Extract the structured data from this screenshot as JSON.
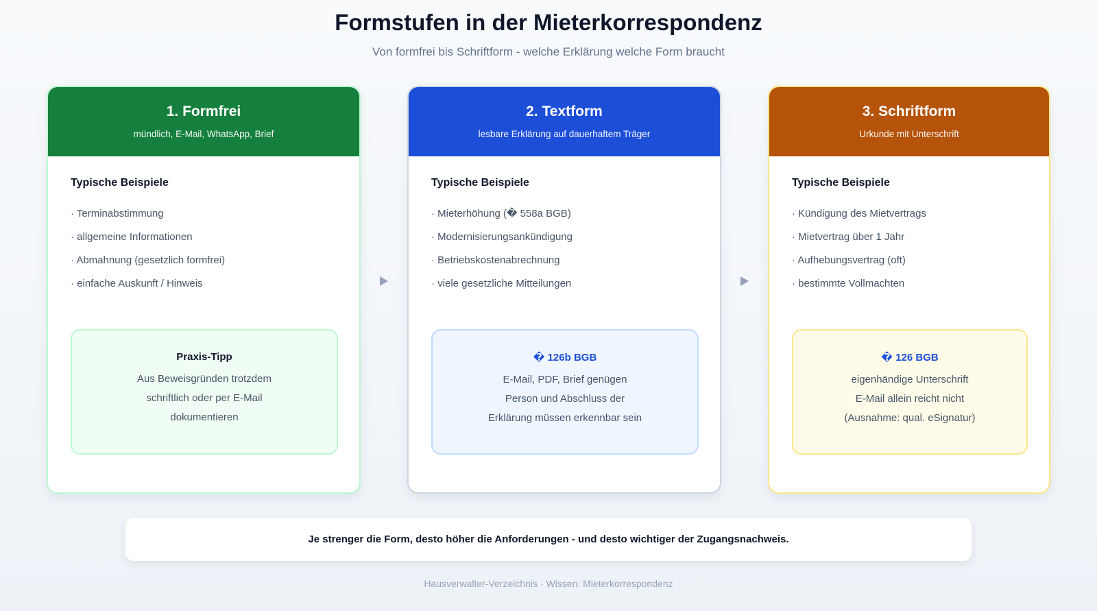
{
  "title": "Formstufen in der Mieterkorrespondenz",
  "subtitle": "Von formfrei bis Schriftform - welche Erklärung welche Form braucht",
  "cards": [
    {
      "title": "1. Formfrei",
      "subtitle": "mündlich, E-Mail, WhatsApp, Brief",
      "header_color": "#15803d",
      "section_title": "Typische Beispiele",
      "items": [
        "· Terminabstimmung",
        "· allgemeine Informationen",
        "· Abmahnung (gesetzlich formfrei)",
        "· einfache Auskunft / Hinweis"
      ],
      "note": {
        "title": "Praxis-Tipp",
        "title_color": "#0f172a",
        "bg_color": "#f0fdf4",
        "border_color": "#bbf7d0",
        "lines": [
          "Aus Beweisgründen trotzdem",
          "schriftlich oder per E-Mail",
          "dokumentieren"
        ]
      }
    },
    {
      "title": "2. Textform",
      "subtitle": "lesbare Erklärung auf dauerhaftem Träger",
      "header_color": "#1d4ed8",
      "section_title": "Typische Beispiele",
      "items": [
        "· Mieterhöhung (� 558a BGB)",
        "· Modernisierungsankündigung",
        "· Betriebskostenabrechnung",
        "· viele gesetzliche Mitteilungen"
      ],
      "note": {
        "title": "� 126b BGB",
        "title_color": "#1d4ed8",
        "bg_color": "#eff6ff",
        "border_color": "#bfdbfe",
        "lines": [
          "E-Mail, PDF, Brief genügen",
          "Person und Abschluss der",
          "Erklärung müssen erkennbar sein"
        ]
      }
    },
    {
      "title": "3. Schriftform",
      "subtitle": "Urkunde mit Unterschrift",
      "header_color": "#b45309",
      "section_title": "Typische Beispiele",
      "items": [
        "· Kündigung des Mietvertrags",
        "· Mietvertrag über 1 Jahr",
        "· Aufhebungsvertrag (oft)",
        "· bestimmte Vollmachten"
      ],
      "note": {
        "title": "� 126 BGB",
        "title_color": "#1d4ed8",
        "bg_color": "#fefce8",
        "border_color": "#fde68a",
        "lines": [
          "eigenhändige Unterschrift",
          "E-Mail allein reicht nicht",
          "(Ausnahme: qual. eSignatur)"
        ]
      }
    }
  ],
  "card_border_colors": [
    "#bbf7d0",
    "#cbd5e1",
    "#fde68a"
  ],
  "arrow_icon": "triangle-right-icon",
  "footer_statement": "Je strenger die Form, desto höher die Anforderungen - und desto wichtiger der Zugangsnachweis.",
  "credit": "Hausverwalter-Verzeichnis · Wissen: Mieterkorrespondenz"
}
